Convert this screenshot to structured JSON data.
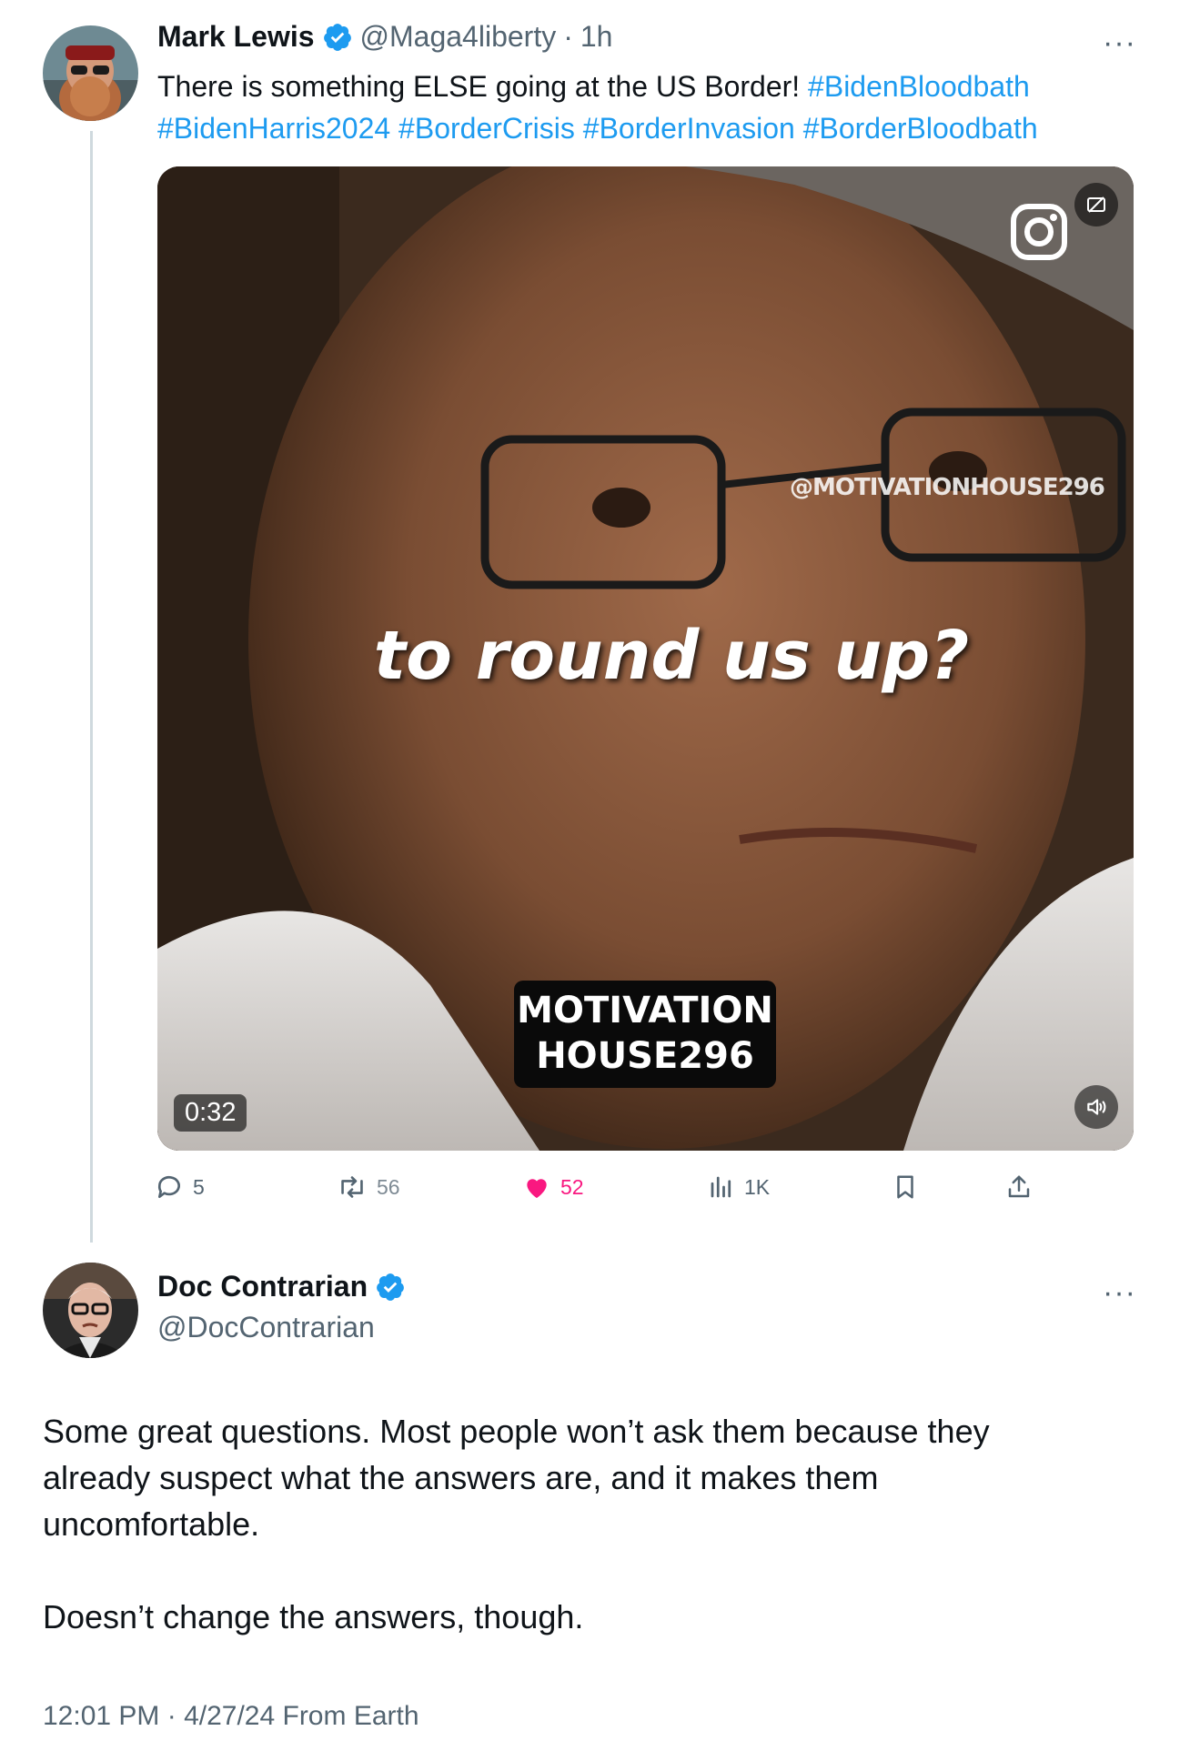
{
  "tweet": {
    "author_name": "Mark Lewis",
    "author_handle": "@Maga4liberty",
    "separator": "·",
    "time_ago": "1h",
    "more": "···",
    "text_plain": "There is something ELSE going at the US Border! ",
    "hashtags_line1": [
      "#BidenBloodbath"
    ],
    "hashtags_line2": [
      "#BidenHarris2024",
      "#BorderCrisis",
      "#BorderInvasion",
      "#BorderBloodbath"
    ],
    "media": {
      "caption": "to round us up?",
      "watermark": "@MOTIVATIONHOUSE296",
      "brand_line1": "MOTIVATION",
      "brand_line2": "HOUSE296",
      "duration": "0:32"
    },
    "actions": {
      "replies": "5",
      "reposts": "56",
      "likes": "52",
      "views": "1K"
    }
  },
  "reply": {
    "author_name": "Doc Contrarian",
    "author_handle": "@DocContrarian",
    "more": "···",
    "paragraph1_line1": "Some great questions. Most people won’t ask them because they",
    "paragraph1_line2": "already suspect what the answers are, and it makes them",
    "paragraph1_line3": "uncomfortable.",
    "paragraph2": "Doesn’t change the answers, though.",
    "timestamp": "12:01 PM · 4/27/24 From Earth"
  },
  "colors": {
    "accent": "#1d9bf0",
    "like": "#f91880",
    "muted": "#536471",
    "text": "#0f1419"
  }
}
